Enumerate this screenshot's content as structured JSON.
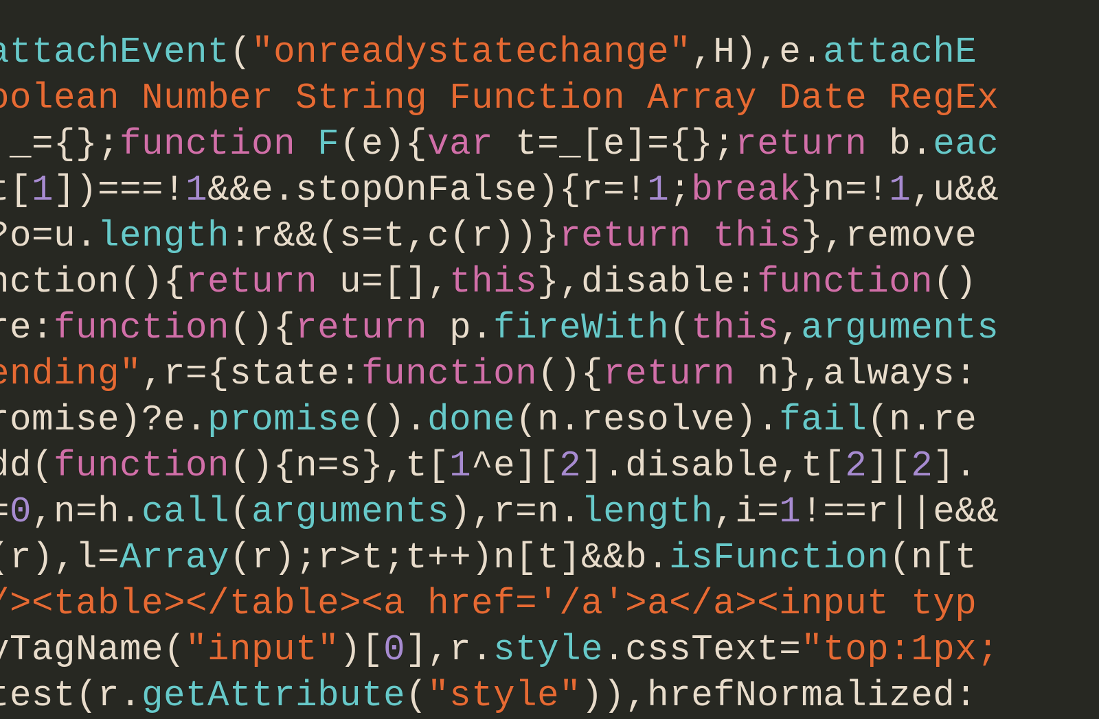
{
  "lines": [
    [
      {
        "cls": "t-teal",
        "t": "attachEvent"
      },
      {
        "cls": "t-cream",
        "t": "("
      },
      {
        "cls": "t-orange",
        "t": "\"onreadystatechange\""
      },
      {
        "cls": "t-cream",
        "t": ",H),e."
      },
      {
        "cls": "t-teal",
        "t": "attachE"
      }
    ],
    [
      {
        "cls": "t-orange",
        "t": "oolean Number String Function Array Date RegEx"
      }
    ],
    [
      {
        "cls": "t-cream",
        "t": " _={};"
      },
      {
        "cls": "t-pink",
        "t": "function"
      },
      {
        "cls": "t-cream",
        "t": " "
      },
      {
        "cls": "t-teal",
        "t": "F"
      },
      {
        "cls": "t-cream",
        "t": "(e){"
      },
      {
        "cls": "t-pink",
        "t": "var"
      },
      {
        "cls": "t-cream",
        "t": " t=_[e]={};"
      },
      {
        "cls": "t-pink",
        "t": "return"
      },
      {
        "cls": "t-cream",
        "t": " b."
      },
      {
        "cls": "t-teal",
        "t": "eac"
      }
    ],
    [
      {
        "cls": "t-cream",
        "t": "t["
      },
      {
        "cls": "t-violet",
        "t": "1"
      },
      {
        "cls": "t-cream",
        "t": "])===!"
      },
      {
        "cls": "t-violet",
        "t": "1"
      },
      {
        "cls": "t-cream",
        "t": "&&e.stopOnFalse){r=!"
      },
      {
        "cls": "t-violet",
        "t": "1"
      },
      {
        "cls": "t-cream",
        "t": ";"
      },
      {
        "cls": "t-pink",
        "t": "break"
      },
      {
        "cls": "t-cream",
        "t": "}n=!"
      },
      {
        "cls": "t-violet",
        "t": "1"
      },
      {
        "cls": "t-cream",
        "t": ",u&&"
      }
    ],
    [
      {
        "cls": "t-cream",
        "t": "?o=u."
      },
      {
        "cls": "t-teal",
        "t": "length"
      },
      {
        "cls": "t-cream",
        "t": ":r&&(s=t,c(r))}"
      },
      {
        "cls": "t-pink",
        "t": "return"
      },
      {
        "cls": "t-cream",
        "t": " "
      },
      {
        "cls": "t-pink",
        "t": "this"
      },
      {
        "cls": "t-cream",
        "t": "},remove"
      }
    ],
    [
      {
        "cls": "t-cream",
        "t": "nction(){"
      },
      {
        "cls": "t-pink",
        "t": "return"
      },
      {
        "cls": "t-cream",
        "t": " u=[],"
      },
      {
        "cls": "t-pink",
        "t": "this"
      },
      {
        "cls": "t-cream",
        "t": "},disable:"
      },
      {
        "cls": "t-pink",
        "t": "function"
      },
      {
        "cls": "t-cream",
        "t": "()"
      }
    ],
    [
      {
        "cls": "t-cream",
        "t": "re:"
      },
      {
        "cls": "t-pink",
        "t": "function"
      },
      {
        "cls": "t-cream",
        "t": "(){"
      },
      {
        "cls": "t-pink",
        "t": "return"
      },
      {
        "cls": "t-cream",
        "t": " p."
      },
      {
        "cls": "t-teal",
        "t": "fireWith"
      },
      {
        "cls": "t-cream",
        "t": "("
      },
      {
        "cls": "t-pink",
        "t": "this"
      },
      {
        "cls": "t-cream",
        "t": ","
      },
      {
        "cls": "t-teal",
        "t": "arguments"
      }
    ],
    [
      {
        "cls": "t-orange",
        "t": "ending\""
      },
      {
        "cls": "t-cream",
        "t": ",r={state:"
      },
      {
        "cls": "t-pink",
        "t": "function"
      },
      {
        "cls": "t-cream",
        "t": "(){"
      },
      {
        "cls": "t-pink",
        "t": "return"
      },
      {
        "cls": "t-cream",
        "t": " n},always:"
      }
    ],
    [
      {
        "cls": "t-cream",
        "t": "romise)?e."
      },
      {
        "cls": "t-teal",
        "t": "promise"
      },
      {
        "cls": "t-cream",
        "t": "()."
      },
      {
        "cls": "t-teal",
        "t": "done"
      },
      {
        "cls": "t-cream",
        "t": "(n.resolve)."
      },
      {
        "cls": "t-teal",
        "t": "fail"
      },
      {
        "cls": "t-cream",
        "t": "(n.re"
      }
    ],
    [
      {
        "cls": "t-cream",
        "t": "dd("
      },
      {
        "cls": "t-pink",
        "t": "function"
      },
      {
        "cls": "t-cream",
        "t": "(){n=s},t["
      },
      {
        "cls": "t-violet",
        "t": "1"
      },
      {
        "cls": "t-cream",
        "t": "^e]["
      },
      {
        "cls": "t-violet",
        "t": "2"
      },
      {
        "cls": "t-cream",
        "t": "].disable,t["
      },
      {
        "cls": "t-violet",
        "t": "2"
      },
      {
        "cls": "t-cream",
        "t": "]["
      },
      {
        "cls": "t-violet",
        "t": "2"
      },
      {
        "cls": "t-cream",
        "t": "]."
      }
    ],
    [
      {
        "cls": "t-cream",
        "t": "="
      },
      {
        "cls": "t-violet",
        "t": "0"
      },
      {
        "cls": "t-cream",
        "t": ",n=h."
      },
      {
        "cls": "t-teal",
        "t": "call"
      },
      {
        "cls": "t-cream",
        "t": "("
      },
      {
        "cls": "t-teal",
        "t": "arguments"
      },
      {
        "cls": "t-cream",
        "t": "),r=n."
      },
      {
        "cls": "t-teal",
        "t": "length"
      },
      {
        "cls": "t-cream",
        "t": ",i="
      },
      {
        "cls": "t-violet",
        "t": "1"
      },
      {
        "cls": "t-cream",
        "t": "!==r||e&&"
      }
    ],
    [
      {
        "cls": "t-cream",
        "t": "(r),l="
      },
      {
        "cls": "t-teal",
        "t": "Array"
      },
      {
        "cls": "t-cream",
        "t": "(r);r>t;t++)n[t]&&b."
      },
      {
        "cls": "t-teal",
        "t": "isFunction"
      },
      {
        "cls": "t-cream",
        "t": "(n[t"
      }
    ],
    [
      {
        "cls": "t-orange",
        "t": "/><table></table><a href='/a'>a</a><input typ"
      }
    ],
    [
      {
        "cls": "t-cream",
        "t": "yTagName("
      },
      {
        "cls": "t-orange",
        "t": "\"input\""
      },
      {
        "cls": "t-cream",
        "t": ")["
      },
      {
        "cls": "t-violet",
        "t": "0"
      },
      {
        "cls": "t-cream",
        "t": "],r."
      },
      {
        "cls": "t-teal",
        "t": "style"
      },
      {
        "cls": "t-cream",
        "t": ".cssText="
      },
      {
        "cls": "t-orange",
        "t": "\"top:1px;"
      }
    ],
    [
      {
        "cls": "t-cream",
        "t": "test(r."
      },
      {
        "cls": "t-teal",
        "t": "getAttribute"
      },
      {
        "cls": "t-cream",
        "t": "("
      },
      {
        "cls": "t-orange",
        "t": "\"style\""
      },
      {
        "cls": "t-cream",
        "t": ")),hrefNormalized:"
      }
    ]
  ]
}
